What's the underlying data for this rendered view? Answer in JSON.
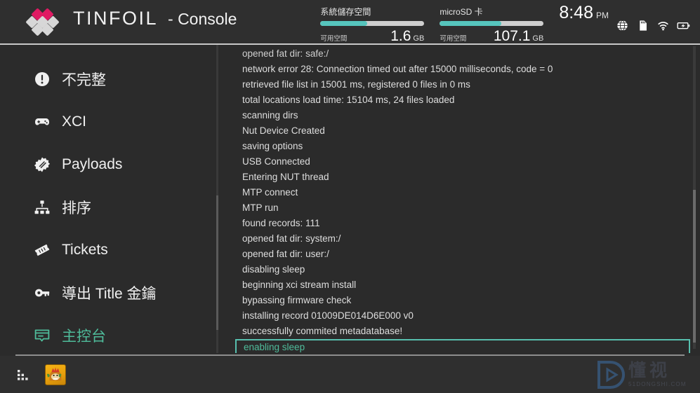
{
  "header": {
    "brand": "TINFOIL",
    "subtitle": "- Console",
    "logo_icon": "tinfoil-diamond-heart-logo"
  },
  "status": {
    "system_storage": {
      "title": "系統儲存空間",
      "free_label": "可用空間",
      "value": "1.6",
      "unit": "GB",
      "used_percent": 45
    },
    "microsd": {
      "title": "microSD 卡",
      "free_label": "可用空間",
      "value": "107.1",
      "unit": "GB",
      "used_percent": 59
    },
    "clock": "8:48",
    "ampm": "PM",
    "icons": [
      "globe-icon",
      "sd-card-icon",
      "wifi-icon",
      "battery-charging-icon"
    ],
    "bar_fill_color": "#56c5bd"
  },
  "sidebar": {
    "items": [
      {
        "label": "不完整",
        "icon": "exclamation-circle-icon",
        "active": false
      },
      {
        "label": "XCI",
        "icon": "gamepad-icon",
        "active": false
      },
      {
        "label": "Payloads",
        "icon": "burst-badge-icon",
        "active": false
      },
      {
        "label": "排序",
        "icon": "sitemap-icon",
        "active": false
      },
      {
        "label": "Tickets",
        "icon": "ticket-icon",
        "active": false
      },
      {
        "label": "導出 Title 金鑰",
        "icon": "key-icon",
        "active": false
      },
      {
        "label": "主控台",
        "icon": "console-terminal-icon",
        "active": true
      }
    ],
    "active_color": "#4fbc9b"
  },
  "console": {
    "lines": [
      "opened fat dir: safe:/",
      "network error 28: Connection timed out after 15000 milliseconds, code = 0",
      "retrieved file list in 15001 ms, registered 0 files in 0 ms",
      "total locations load time: 15104 ms, 24 files loaded",
      "scanning dirs",
      "Nut Device Created",
      "saving options",
      "USB Connected",
      "Entering NUT thread",
      "MTP connect",
      "MTP run",
      "found records: 111",
      "opened fat dir: system:/",
      "opened fat dir: user:/",
      "disabling sleep",
      "beginning xci stream install",
      "bypassing firmware check",
      "installing record 01009DE014D6E000 v0",
      "successfully commited metadatabase!"
    ],
    "highlighted_line": "enabling sleep",
    "highlight_color": "#4fbc9b"
  },
  "footer": {
    "apps_icon": "app-grid-icon",
    "game_tile_icon": "game-thumbnail"
  },
  "watermark": {
    "cn": "懂视",
    "en": "51DONGSHI.COM",
    "logo_icon": "play-button-logo"
  }
}
